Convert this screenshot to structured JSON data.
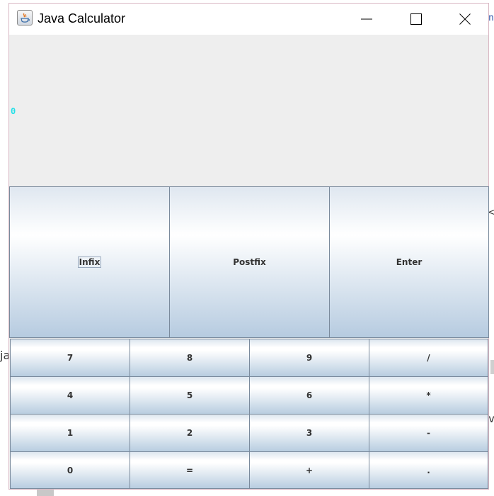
{
  "window": {
    "title": "Java Calculator"
  },
  "display": {
    "value": "0"
  },
  "mode_buttons": [
    {
      "label": "Infix"
    },
    {
      "label": "Postfix"
    },
    {
      "label": "Enter"
    }
  ],
  "keypad": [
    {
      "label": "7"
    },
    {
      "label": "8"
    },
    {
      "label": "9"
    },
    {
      "label": "/"
    },
    {
      "label": "4"
    },
    {
      "label": "5"
    },
    {
      "label": "6"
    },
    {
      "label": "*"
    },
    {
      "label": "1"
    },
    {
      "label": "2"
    },
    {
      "label": "3"
    },
    {
      "label": "-"
    },
    {
      "label": "0"
    },
    {
      "label": "="
    },
    {
      "label": "+"
    },
    {
      "label": "."
    }
  ],
  "colors": {
    "display_text": "#22e0e8",
    "window_bg": "#eeeeee"
  }
}
